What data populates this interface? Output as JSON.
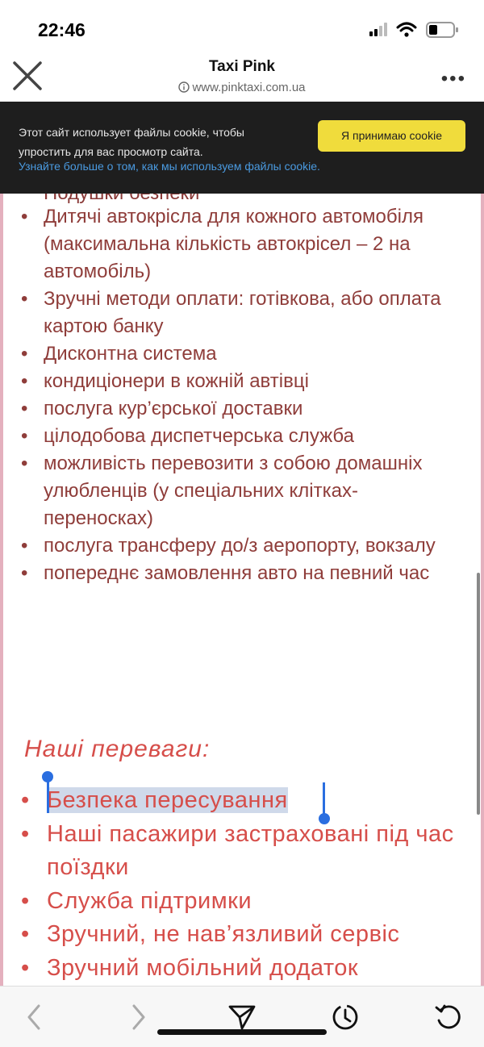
{
  "status_bar": {
    "time": "22:46"
  },
  "header": {
    "title": "Taxi Pink",
    "url": "www.pinktaxi.com.ua"
  },
  "cookie_banner": {
    "text": "Этот сайт использует файлы cookie, чтобы упростить для вас просмотр сайта.",
    "link": "Узнайте больше о том, как мы используем файлы cookie.",
    "accept_button": "Я принимаю cookie",
    "accent_color": "#f0dc3c"
  },
  "content": {
    "partial_top": "Подушки безпеки",
    "features": [
      "Дитячі автокрісла для кожного автомобіля (максимальна кількість автокрісел – 2 на автомобіль)",
      "Зручні методи оплати: готівкова, або оплата картою банку",
      "Дисконтна система",
      " кондиціонери в кожній автівці",
      "послуга кур’єрської доставки",
      " цілодобова диспетчерська служба",
      "можливість перевозити з собою домашніх улюбленців (у спеціальних клітках-переносках)",
      "послуга трансферу до/з аеропорту, вокзалу",
      "попереднє замовлення авто на певний час"
    ],
    "advantages_heading": "Наші переваги:",
    "advantages": [
      "Безпека пересування",
      "Наші пасажири застраховані під час поїздки",
      "Служба підтримки",
      "Зручний, не нав’язливий сервіс",
      "Зручний мобільний додаток"
    ],
    "text_color": "#8f3d3a",
    "accent_color": "#d64e4a"
  },
  "toolbar": {
    "icons": [
      "back-icon",
      "forward-icon",
      "share-icon",
      "history-icon",
      "reload-icon"
    ]
  }
}
